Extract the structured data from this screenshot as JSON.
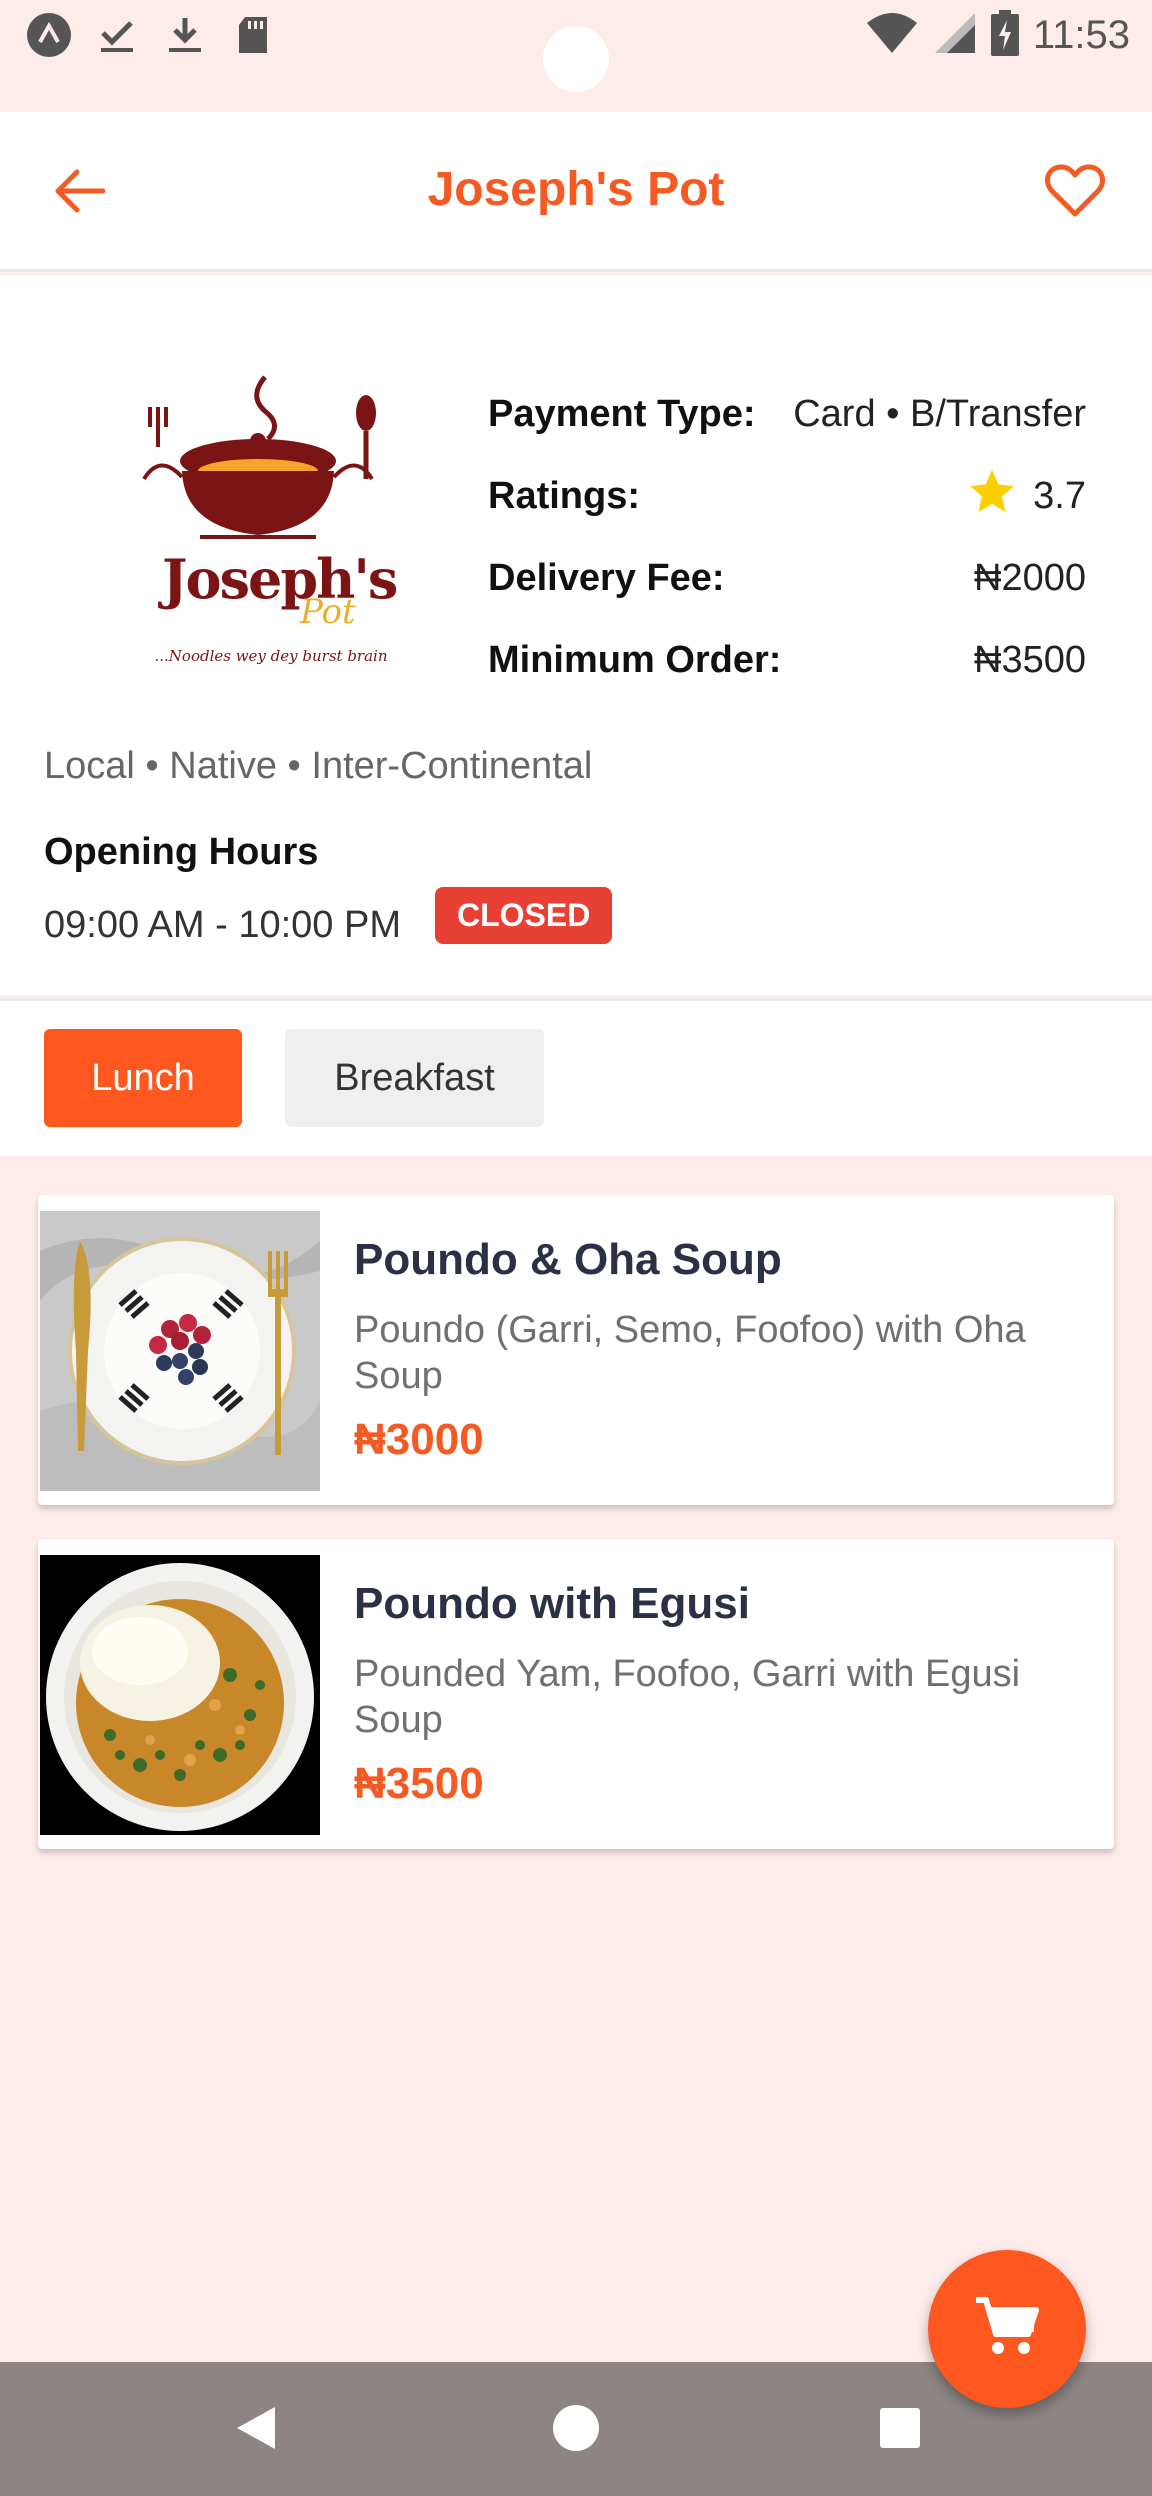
{
  "status_bar": {
    "time": "11:53",
    "left_icons": [
      "app-a-icon",
      "check-download-icon",
      "download-icon",
      "sd-card-icon"
    ],
    "right_icons": [
      "wifi-icon",
      "signal-icon",
      "battery-charging-icon"
    ]
  },
  "header": {
    "title": "Joseph's Pot",
    "back_icon": "arrow-left-icon",
    "favorite_icon": "heart-outline-icon",
    "accent_color": "#f45a22"
  },
  "restaurant": {
    "logo": {
      "name": "Joseph's",
      "script": "Pot",
      "tagline": "...Noodles wey dey burst brain"
    },
    "details": [
      {
        "label": "Payment Type:",
        "value": "Card • B/Transfer"
      },
      {
        "label": "Ratings:",
        "value": "3.7",
        "icon": "star-icon"
      },
      {
        "label": "Delivery Fee:",
        "value": "₦2000"
      },
      {
        "label": "Minimum Order:",
        "value": "₦3500"
      }
    ],
    "cuisines": "Local • Native • Inter-Continental",
    "opening_hours_title": "Opening Hours",
    "opening_hours": "09:00 AM - 10:00 PM",
    "status_badge": "CLOSED",
    "status_color": "#e94035"
  },
  "tabs": [
    {
      "label": "Lunch",
      "active": true
    },
    {
      "label": "Breakfast",
      "active": false
    }
  ],
  "menu": [
    {
      "name": "Poundo & Oha Soup",
      "description": "Poundo (Garri, Semo, Foofoo) with Oha Soup",
      "price": "₦3000"
    },
    {
      "name": "Poundo with Egusi",
      "description": "Pounded Yam, Foofoo, Garri with Egusi Soup",
      "price": "₦3500"
    }
  ],
  "cart_fab": {
    "icon": "cart-icon"
  },
  "nav_bar": {
    "icons": [
      "nav-back-icon",
      "nav-home-icon",
      "nav-recents-icon"
    ]
  }
}
